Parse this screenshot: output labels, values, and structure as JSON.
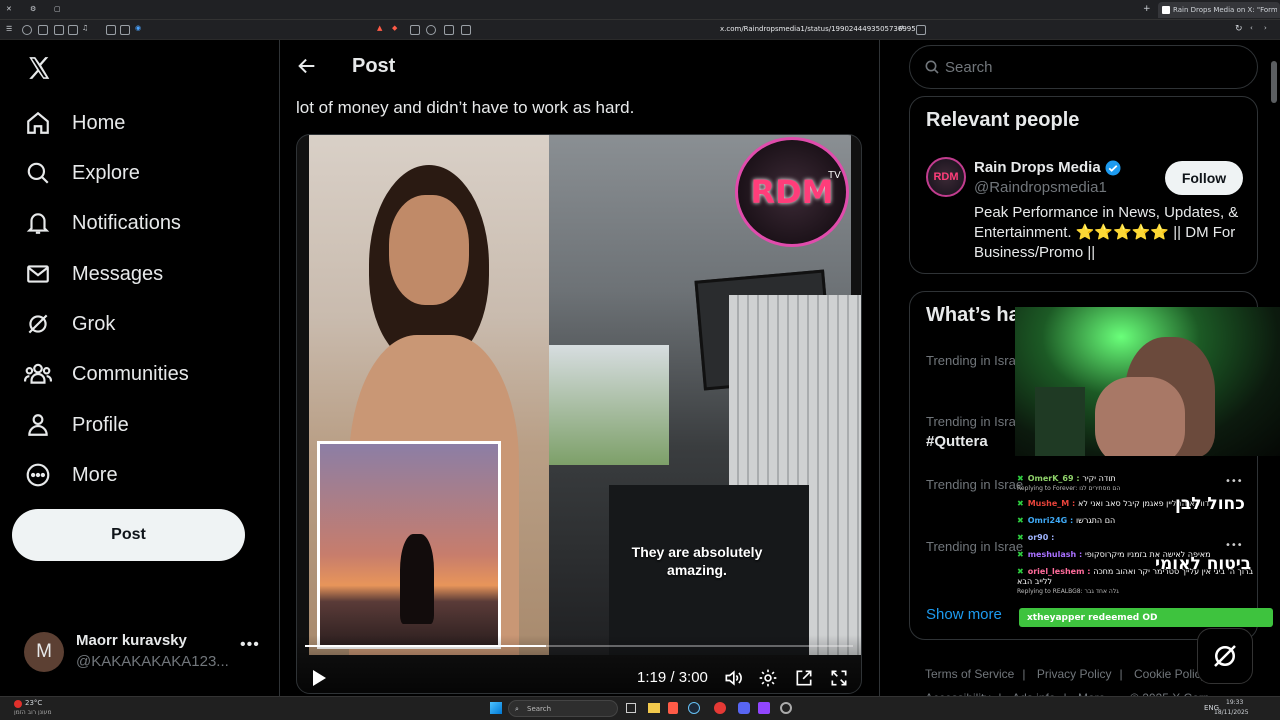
{
  "browser": {
    "tab_title": "Rain Drops Media on X: \"Forme",
    "url": "x.com/Raindropsmedia1/status/1990244493505736995"
  },
  "nav": {
    "items": [
      {
        "label": "Home",
        "icon": "home-icon"
      },
      {
        "label": "Explore",
        "icon": "search-icon"
      },
      {
        "label": "Notifications",
        "icon": "bell-icon"
      },
      {
        "label": "Messages",
        "icon": "mail-icon"
      },
      {
        "label": "Grok",
        "icon": "grok-icon"
      },
      {
        "label": "Communities",
        "icon": "people-icon"
      },
      {
        "label": "Profile",
        "icon": "person-icon"
      },
      {
        "label": "More",
        "icon": "more-circle-icon"
      }
    ],
    "post_label": "Post",
    "account": {
      "name": "Maorr kuravsky",
      "handle": "@KAKAKAKAKA123...",
      "initial": "M"
    }
  },
  "main": {
    "header_title": "Post",
    "tweet_text": "lot of money and didn’t have to work as hard.",
    "video": {
      "badge": "RDM",
      "badge_tv": "TV",
      "caption_line1": "They are absolutely",
      "caption_line2": "amazing.",
      "time": "1:19 / 3:00",
      "progress": 0.439
    }
  },
  "right": {
    "search_placeholder": "Search",
    "relevant": {
      "title": "Relevant people",
      "name": "Rain Drops Media",
      "handle": "@Raindropsmedia1",
      "follow_label": "Follow",
      "bio": "Peak Performance in News, Updates, & Entertainment. ⭐⭐⭐⭐⭐ || DM For Business/Promo ||"
    },
    "happening": {
      "title": "What’s ha",
      "trends": [
        {
          "context": "Trending in Isra",
          "name": ""
        },
        {
          "context": "Trending in Isra",
          "name": "#Quttera"
        },
        {
          "context": "Trending in Israe",
          "name": ""
        },
        {
          "context": "Trending in Israe",
          "name": ""
        }
      ],
      "show_more": "Show more"
    },
    "footer": [
      "Terms of Service",
      "Privacy Policy",
      "Cookie Policy",
      "Accessibility",
      "Ads info",
      "More ...",
      "© 2025 X Corp."
    ]
  },
  "overlay": {
    "chat": [
      {
        "user": "OmerK_69",
        "reply": "Replying to Forever: הם מסתירים לנו",
        "text": "תודה יקיר",
        "user_color": "#8fd16a"
      },
      {
        "user": "Mushe_M",
        "reply": "",
        "text": "דווקא החליין פאגמן קיבל סאב ואני לא",
        "user_color": "#e8433b"
      },
      {
        "user": "Omri24G",
        "reply": "",
        "text": "הם התגרשו",
        "user_color": "#3fa9f5"
      },
      {
        "user": "or90",
        "reply": "",
        "text": "",
        "user_color": "#9fb4ff"
      },
      {
        "user": "meshulash",
        "reply": "",
        "text": "מאיפה לאישה את בזמניו מיקרוסקופי",
        "user_color": "#a970ff"
      },
      {
        "user": "oriel_leshem",
        "reply": "Replying to REALBG8: גלה אחד גבר",
        "text": "ברוך ה' ביגי אין עלייך סטרימר יקר ואהוב מחכה ללייב הבא",
        "user_color": "#ff6b9b"
      }
    ],
    "hebrew_title1": "כחול לבן",
    "hebrew_title2": "ביטוח לאומי",
    "redeemed": "xtheyapper redeemed OD"
  },
  "taskbar": {
    "weather_temp": "23°C",
    "weather_desc": "מעונן רוב הזמן",
    "search_label": "Search",
    "time": "19:33",
    "date": "18/11/2025",
    "lang": "ENG"
  },
  "colors": {
    "accent": "#1d9bf0",
    "verified": "#1d9bf0",
    "border": "#2f3336",
    "muted": "#71767b"
  }
}
